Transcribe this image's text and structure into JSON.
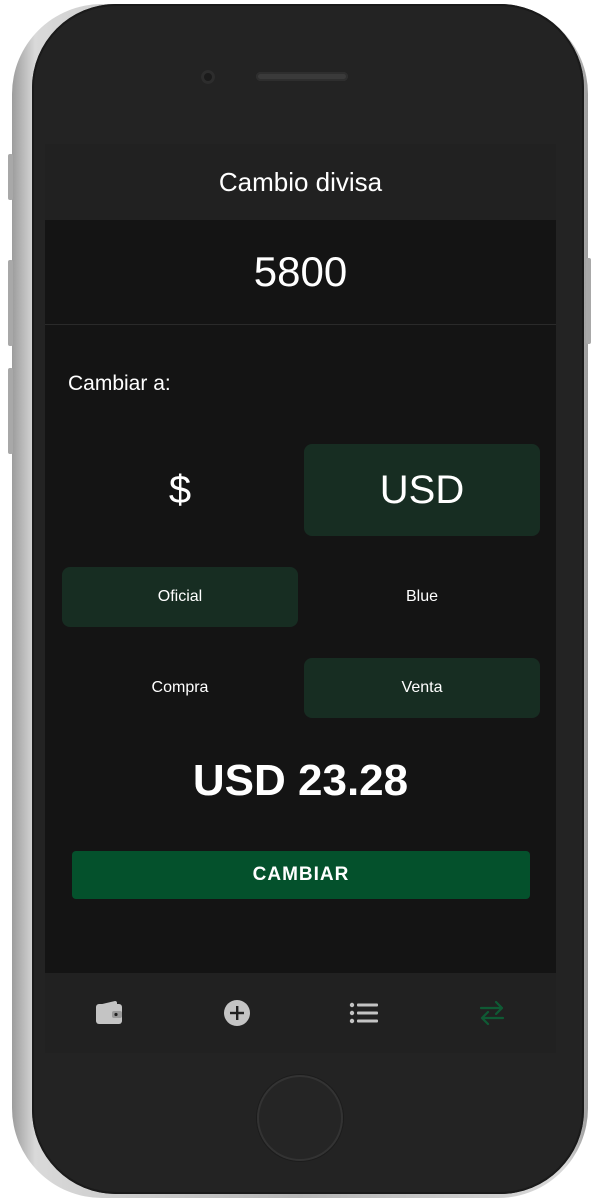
{
  "appbar": {
    "title": "Cambio divisa"
  },
  "amount": {
    "value": "5800"
  },
  "change_label": "Cambiar a:",
  "currency_options": [
    {
      "label": "$",
      "selected": false
    },
    {
      "label": "USD",
      "selected": true
    }
  ],
  "rate_type_options": [
    {
      "label": "Oficial",
      "selected": true
    },
    {
      "label": "Blue",
      "selected": false
    }
  ],
  "operation_options": [
    {
      "label": "Compra",
      "selected": false
    },
    {
      "label": "Venta",
      "selected": true
    }
  ],
  "result": {
    "text": "USD 23.28"
  },
  "convert_button": {
    "label": "CAMBIAR"
  },
  "bottom_nav": [
    {
      "icon": "wallet-icon",
      "active": false
    },
    {
      "icon": "add-circle-icon",
      "active": false
    },
    {
      "icon": "list-icon",
      "active": false
    },
    {
      "icon": "swap-arrows-icon",
      "active": true
    }
  ],
  "colors": {
    "screen_background": "#141414",
    "appbar_background": "#212121",
    "selected_option": "#172d22",
    "primary_button": "#04512c",
    "nav_icon_inactive": "#c4c4c4",
    "nav_icon_active": "#0f5a34"
  }
}
